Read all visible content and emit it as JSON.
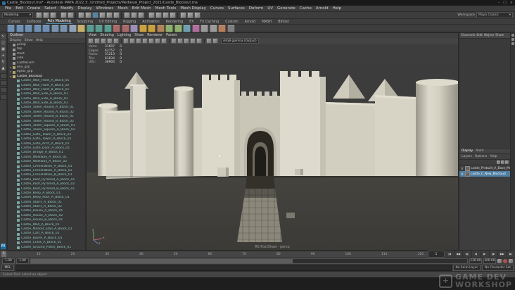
{
  "window": {
    "title": "Castle_Blockout.ma* - Autodesk MAYA 2022.3: /Untitled_Projects/Medieval_Project_2021/Castle_Blockout.ma",
    "minimize": "–",
    "maximize": "□",
    "close": "×"
  },
  "menubar": {
    "items": [
      "File",
      "Edit",
      "Create",
      "Select",
      "Modify",
      "Display",
      "Windows",
      "Mesh",
      "Edit Mesh",
      "Mesh Tools",
      "Mesh Display",
      "Curves",
      "Surfaces",
      "Deform",
      "UV",
      "Generate",
      "Cache",
      "Arnold",
      "Help"
    ]
  },
  "statusline": {
    "menu_set": "Modeling",
    "caret": "▾",
    "workspace_label": "Workspace",
    "workspace_value": "Maya Classic",
    "icons": [
      {
        "t": "i",
        "n": "new-scene-icon"
      },
      {
        "t": "i",
        "n": "open-scene-icon"
      },
      {
        "t": "i",
        "n": "save-scene-icon"
      },
      {
        "t": "s"
      },
      {
        "t": "i",
        "n": "undo-icon"
      },
      {
        "t": "i",
        "n": "redo-icon"
      },
      {
        "t": "s"
      },
      {
        "t": "i",
        "n": "snap-grid-icon"
      },
      {
        "t": "i",
        "n": "snap-curve-icon"
      },
      {
        "t": "i",
        "n": "snap-point-icon",
        "c": "#5285a6"
      },
      {
        "t": "i",
        "n": "snap-plane-icon"
      },
      {
        "t": "i",
        "n": "snap-view-icon"
      },
      {
        "t": "i",
        "n": "make-live-icon"
      },
      {
        "t": "s"
      },
      {
        "t": "i",
        "n": "construction-history-icon"
      },
      {
        "t": "i",
        "n": "symmetry-icon"
      },
      {
        "t": "i",
        "n": "highlight-selection-icon"
      },
      {
        "t": "s"
      },
      {
        "t": "i",
        "n": "render-frame-icon"
      },
      {
        "t": "i",
        "n": "ipr-render-icon"
      },
      {
        "t": "i",
        "n": "render-settings-icon"
      },
      {
        "t": "i",
        "n": "display-layers-icon"
      },
      {
        "t": "s"
      },
      {
        "t": "i",
        "n": "paint-effects-icon"
      },
      {
        "t": "i",
        "n": "hypershade-icon"
      },
      {
        "t": "i",
        "n": "node-editor-icon"
      }
    ]
  },
  "shelf": {
    "tabs": [
      {
        "label": "Curves"
      },
      {
        "label": "Surfaces"
      },
      {
        "label": "Poly Modeling",
        "cls": "active"
      },
      {
        "label": "Sculpting"
      },
      {
        "label": "UV Editing"
      },
      {
        "label": "Rigging"
      },
      {
        "label": "Animation"
      },
      {
        "label": "Rendering"
      },
      {
        "label": "FX"
      },
      {
        "label": "FX Caching"
      },
      {
        "label": "Custom"
      },
      {
        "label": "Arnold"
      },
      {
        "label": "MASH"
      },
      {
        "label": "Bifrost"
      }
    ],
    "icons": [
      {
        "n": "poly-sphere-icon",
        "c": "#6f8fb3"
      },
      {
        "n": "poly-cube-icon",
        "c": "#6f8fb3"
      },
      {
        "n": "poly-cylinder-icon",
        "c": "#6f8fb3"
      },
      {
        "n": "poly-plane-icon",
        "c": "#6f8fb3"
      },
      {
        "n": "poly-torus-icon",
        "c": "#6f8fb3"
      },
      {
        "n": "poly-cone-icon",
        "c": "#7a93ae"
      },
      {
        "n": "poly-disc-icon",
        "c": "#7a93ae"
      },
      {
        "n": "platonic-solid-icon",
        "c": "#8fa3b8"
      },
      {
        "n": "super-shape-icon",
        "c": "#c9b06a"
      },
      {
        "n": "boolean-union-icon",
        "c": "#5a9a8f"
      },
      {
        "n": "boolean-difference-icon",
        "c": "#5a9a8f"
      },
      {
        "n": "boolean-intersect-icon",
        "c": "#5a9a8f"
      },
      {
        "n": "combine-icon",
        "c": "#a86969"
      },
      {
        "n": "separate-icon",
        "c": "#a86969"
      },
      {
        "n": "extract-icon",
        "c": "#9a8fb8"
      },
      {
        "n": "bevel-icon",
        "c": "#c9a23f"
      },
      {
        "n": "bridge-icon",
        "c": "#c9a23f"
      },
      {
        "n": "extrude-icon",
        "c": "#b0835a"
      },
      {
        "n": "multi-cut-icon",
        "c": "#8faf6f"
      },
      {
        "n": "target-weld-icon",
        "c": "#8faf6f"
      },
      {
        "n": "quad-draw-icon",
        "c": "#6fa0af"
      },
      {
        "n": "mirror-icon",
        "c": "#af6f9a"
      },
      {
        "n": "smooth-icon",
        "c": "#9a9a9a"
      },
      {
        "n": "crease-icon",
        "c": "#9a9a9a"
      },
      {
        "n": "sculpt-tool-icon",
        "c": "#b37f5f"
      },
      {
        "n": "soft-select-icon",
        "c": "#7f7f7f"
      }
    ]
  },
  "toolbox": {
    "tools": [
      {
        "g": "↖",
        "n": "select-tool"
      },
      {
        "g": "○",
        "n": "lasso-select-tool"
      },
      {
        "g": "▣",
        "n": "paint-select-tool"
      },
      {
        "g": "+",
        "n": "move-tool"
      },
      {
        "g": "↻",
        "n": "rotate-tool"
      },
      {
        "g": "▲",
        "n": "scale-tool"
      }
    ],
    "layouts": [
      {
        "n": "layout-single-pane"
      },
      {
        "n": "layout-four-pane"
      },
      {
        "n": "layout-persp-outliner"
      },
      {
        "n": "layout-persp-uv"
      }
    ],
    "logo": "M"
  },
  "outliner": {
    "title": "Outliner",
    "menu": [
      "Display",
      "Show",
      "Help"
    ],
    "items": [
      {
        "pre": "",
        "cls": "cam",
        "name": "persp"
      },
      {
        "pre": "",
        "cls": "cam",
        "name": "top"
      },
      {
        "pre": "",
        "cls": "cam",
        "name": "front"
      },
      {
        "pre": "",
        "cls": "cam",
        "name": "side"
      },
      {
        "pre": "",
        "cls": "cam",
        "name": "CastleCam"
      },
      {
        "pre": "▸",
        "cls": "grp",
        "name": "env_grp"
      },
      {
        "pre": "▸",
        "cls": "grp",
        "name": "lights_grp"
      },
      {
        "pre": "▾",
        "cls": "root",
        "name": "Castle_Blockout"
      },
      {
        "pre": "",
        "cls": "mesh",
        "name": "Castle_Wall_Front_A_Block_01"
      },
      {
        "pre": "",
        "cls": "mesh",
        "name": "Castle_Wall_Front_A_Block_02"
      },
      {
        "pre": "",
        "cls": "mesh",
        "name": "Castle_Wall_Front_B_Block_01"
      },
      {
        "pre": "",
        "cls": "mesh",
        "name": "Castle_Wall_Side_A_Block_01"
      },
      {
        "pre": "",
        "cls": "mesh",
        "name": "Castle_Wall_Side_A_Block_02"
      },
      {
        "pre": "",
        "cls": "mesh",
        "name": "Castle_Wall_Side_B_Block_01"
      },
      {
        "pre": "",
        "cls": "mesh",
        "name": "Castle_Tower_Round_A_Block_01"
      },
      {
        "pre": "",
        "cls": "mesh",
        "name": "Castle_Tower_Round_A_Block_02"
      },
      {
        "pre": "",
        "cls": "mesh",
        "name": "Castle_Tower_Round_B_Block_01"
      },
      {
        "pre": "",
        "cls": "mesh",
        "name": "Castle_Tower_Round_B_Block_02"
      },
      {
        "pre": "",
        "cls": "mesh",
        "name": "Castle_Tower_Square_A_Block_01"
      },
      {
        "pre": "",
        "cls": "mesh",
        "name": "Castle_Tower_Square_A_Block_02"
      },
      {
        "pre": "",
        "cls": "mesh",
        "name": "Castle_Gate_Tower_A_Block_01"
      },
      {
        "pre": "",
        "cls": "mesh",
        "name": "Castle_Gate_Tower_A_Block_02"
      },
      {
        "pre": "",
        "cls": "mesh",
        "name": "Castle_Gate_Arch_A_Block_01"
      },
      {
        "pre": "",
        "cls": "mesh",
        "name": "Castle_Gate_Door_A_Block_01"
      },
      {
        "pre": "",
        "cls": "mesh",
        "name": "Castle_Bridge_A_Block_01"
      },
      {
        "pre": "",
        "cls": "mesh",
        "name": "Castle_Walkway_A_Block_01"
      },
      {
        "pre": "",
        "cls": "mesh",
        "name": "Castle_Walkway_A_Block_02"
      },
      {
        "pre": "",
        "cls": "mesh",
        "name": "Castle_Crenellation_A_Block_01"
      },
      {
        "pre": "",
        "cls": "mesh",
        "name": "Castle_Crenellation_A_Block_02"
      },
      {
        "pre": "",
        "cls": "mesh",
        "name": "Castle_Crenellation_B_Block_01"
      },
      {
        "pre": "",
        "cls": "mesh",
        "name": "Castle_Roof_Pyramid_A_Block_01"
      },
      {
        "pre": "",
        "cls": "mesh",
        "name": "Castle_Roof_Pyramid_A_Block_02"
      },
      {
        "pre": "",
        "cls": "mesh",
        "name": "Castle_Roof_Pyramid_B_Block_01"
      },
      {
        "pre": "",
        "cls": "mesh",
        "name": "Castle_Keep_A_Block_01"
      },
      {
        "pre": "",
        "cls": "mesh",
        "name": "Castle_Keep_Roof_A_Block_01"
      },
      {
        "pre": "",
        "cls": "mesh",
        "name": "Castle_Stairs_A_Block_01"
      },
      {
        "pre": "",
        "cls": "mesh",
        "name": "Castle_Stairs_A_Block_02"
      },
      {
        "pre": "",
        "cls": "mesh",
        "name": "Castle_House_A_Block_01"
      },
      {
        "pre": "",
        "cls": "mesh",
        "name": "Castle_House_A_Block_02"
      },
      {
        "pre": "",
        "cls": "mesh",
        "name": "Castle_House_B_Block_01"
      },
      {
        "pre": "",
        "cls": "mesh",
        "name": "Castle_Well_A_Block_01"
      },
      {
        "pre": "",
        "cls": "mesh",
        "name": "Castle_Market_Stall_A_Block_01"
      },
      {
        "pre": "",
        "cls": "mesh",
        "name": "Castle_Cart_A_Block_01"
      },
      {
        "pre": "",
        "cls": "mesh",
        "name": "Castle_Barrel_A_Block_01"
      },
      {
        "pre": "",
        "cls": "mesh",
        "name": "Castle_Crate_A_Block_01"
      },
      {
        "pre": "",
        "cls": "mesh",
        "name": "Castle_Ground_Plane_Block_01"
      }
    ]
  },
  "viewport": {
    "menu": [
      "View",
      "Shading",
      "Lighting",
      "Show",
      "Renderer",
      "Panels"
    ],
    "colorspace": "sRGB gamma (Output)",
    "toolbar": [
      {
        "t": "i",
        "n": "lock-camera-icon"
      },
      {
        "t": "i",
        "n": "camera-attributes-icon"
      },
      {
        "t": "i",
        "n": "bookmarks-icon"
      },
      {
        "t": "i",
        "n": "image-plane-icon"
      },
      {
        "t": "i",
        "n": "2d-pan-zoom-icon"
      },
      {
        "t": "s"
      },
      {
        "t": "i",
        "n": "wireframe-icon"
      },
      {
        "t": "i",
        "n": "smooth-shade-icon"
      },
      {
        "t": "i",
        "n": "textured-icon"
      },
      {
        "t": "i",
        "n": "use-lights-icon"
      },
      {
        "t": "i",
        "n": "shadows-icon"
      },
      {
        "t": "i",
        "n": "ambient-occlusion-icon"
      },
      {
        "t": "i",
        "n": "anti-alias-icon"
      },
      {
        "t": "s"
      },
      {
        "t": "i",
        "n": "isolate-select-icon"
      },
      {
        "t": "i",
        "n": "field-chart-icon"
      },
      {
        "t": "i",
        "n": "resolution-gate-icon"
      },
      {
        "t": "i",
        "n": "gate-mask-icon"
      },
      {
        "t": "i",
        "n": "safe-action-icon"
      },
      {
        "t": "s"
      },
      {
        "t": "i",
        "n": "exposure-icon"
      },
      {
        "t": "i",
        "n": "gamma-icon"
      }
    ],
    "hud": {
      "rows": [
        {
          "label": "Verts:",
          "v1": "31697",
          "v2": "0"
        },
        {
          "label": "Edges:",
          "v1": "62757",
          "v2": "0"
        },
        {
          "label": "Faces:",
          "v1": "31213",
          "v2": "0"
        },
        {
          "label": "Tris:",
          "v1": "61834",
          "v2": "0"
        },
        {
          "label": "UVs:",
          "v1": "36904",
          "v2": "0"
        }
      ]
    },
    "camera_label": "R5:PostShow - persp",
    "axis": {
      "x": "x",
      "y": "y",
      "z": "z"
    }
  },
  "channel_box": {
    "menus": [
      "Channels",
      "Edit",
      "Object",
      "Show"
    ]
  },
  "layers": {
    "tabs": [
      {
        "label": "Display",
        "cls": "active"
      },
      {
        "label": "Anim"
      }
    ],
    "menu": [
      "Layers",
      "Options",
      "Help"
    ],
    "toolbar": [
      {
        "n": "layer-move-up-icon"
      },
      {
        "n": "new-empty-layer-icon"
      },
      {
        "n": "new-layer-from-selected-icon"
      }
    ],
    "items": [
      {
        "v": "V",
        "name": "castle_Prebuilt_A_Base_Mesh"
      },
      {
        "v": "V",
        "name": "castle_C_New_Blockout",
        "cls": "sel"
      }
    ]
  },
  "timeline": {
    "ticks": [
      "1",
      "10",
      "20",
      "30",
      "40",
      "50",
      "60",
      "70",
      "80",
      "90",
      "100",
      "110",
      "120"
    ],
    "current": "1",
    "playback": [
      {
        "g": "|◀",
        "n": "go-to-start-button"
      },
      {
        "g": "◀◀",
        "n": "step-back-frame-button"
      },
      {
        "g": "◀|",
        "n": "step-back-key-button"
      },
      {
        "g": "◀",
        "n": "play-backwards-button"
      },
      {
        "g": "▶",
        "n": "play-forwards-button"
      },
      {
        "g": "|▶",
        "n": "step-forward-key-button"
      },
      {
        "g": "▶▶",
        "n": "step-forward-frame-button"
      },
      {
        "g": "▶|",
        "n": "go-to-end-button"
      }
    ]
  },
  "range": {
    "s1": "1.00",
    "s2": "1.00",
    "e1": "120.00",
    "e2": "200.00",
    "icons": [
      {
        "n": "playback-options-icon"
      },
      {
        "n": "auto-keyframe-icon",
        "c": "red"
      },
      {
        "n": "animation-preferences-icon"
      }
    ]
  },
  "commandline": {
    "label": "MEL",
    "right_items": [
      "No Anim Layer",
      "No Character Set"
    ]
  },
  "helpline": {
    "text": "Select Tool: select an object"
  },
  "watermark": {
    "icon": "+",
    "line1": "GAME DEV",
    "line2": "WORKSHOP"
  },
  "colors": {
    "accent": "#5285a6",
    "castle_light": "#d8d5c7",
    "viewport_bg": "#3a3a3a",
    "selection_blue": "#4f7ea3"
  }
}
